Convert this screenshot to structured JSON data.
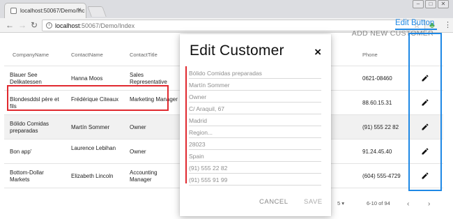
{
  "browser": {
    "tab_title": "localhost:50067/Demo/Inc",
    "tab_close": "×",
    "url_host": "localhost",
    "url_path": ":50067/Demo/Index"
  },
  "page": {
    "add_new_label": "ADD NEW CUSTOMER",
    "columns": [
      "CompanyName",
      "ContactName",
      "ContactTitle",
      "Phone"
    ],
    "rows": [
      {
        "company": "Blauer See Delikatessen",
        "contact": "Hanna Moos",
        "title": "Sales Representative",
        "phone": "0621-08460"
      },
      {
        "company": "Blondesddsl père et fils",
        "contact": "Frédérique Citeaux",
        "title": "Marketing Manager",
        "phone": "88.60.15.31"
      },
      {
        "company": "Bólido Comidas preparadas",
        "contact": "Martín Sommer",
        "title": "Owner",
        "phone": "(91) 555 22 82"
      },
      {
        "company": "Bon app'",
        "contact": "Laurence Lebihan",
        "title": "Owner",
        "phone": "91.24.45.40"
      },
      {
        "company": "Bottom-Dollar Markets",
        "contact": "Elizabeth Lincoln",
        "title": "Accounting Manager",
        "phone": "(604) 555-4729"
      }
    ],
    "selected_row_index": 2,
    "pager": {
      "page_size": "5",
      "range": "6-10 of 94",
      "prev": "‹",
      "next": "›"
    }
  },
  "annotation": {
    "edit_button_label": "Edit Button",
    "highlight_color": "#e0282e",
    "edit_color": "#1e88e5"
  },
  "modal": {
    "title": "Edit Customer",
    "close": "×",
    "fields": [
      "Bólido Comidas preparadas",
      "Martín Sommer",
      "Owner",
      "C/ Araquil, 67",
      "Madrid",
      "Region...",
      "28023",
      "Spain",
      "(91) 555 22 82",
      "(91) 555 91 99"
    ],
    "cancel_label": "CANCEL",
    "save_label": "SAVE"
  }
}
